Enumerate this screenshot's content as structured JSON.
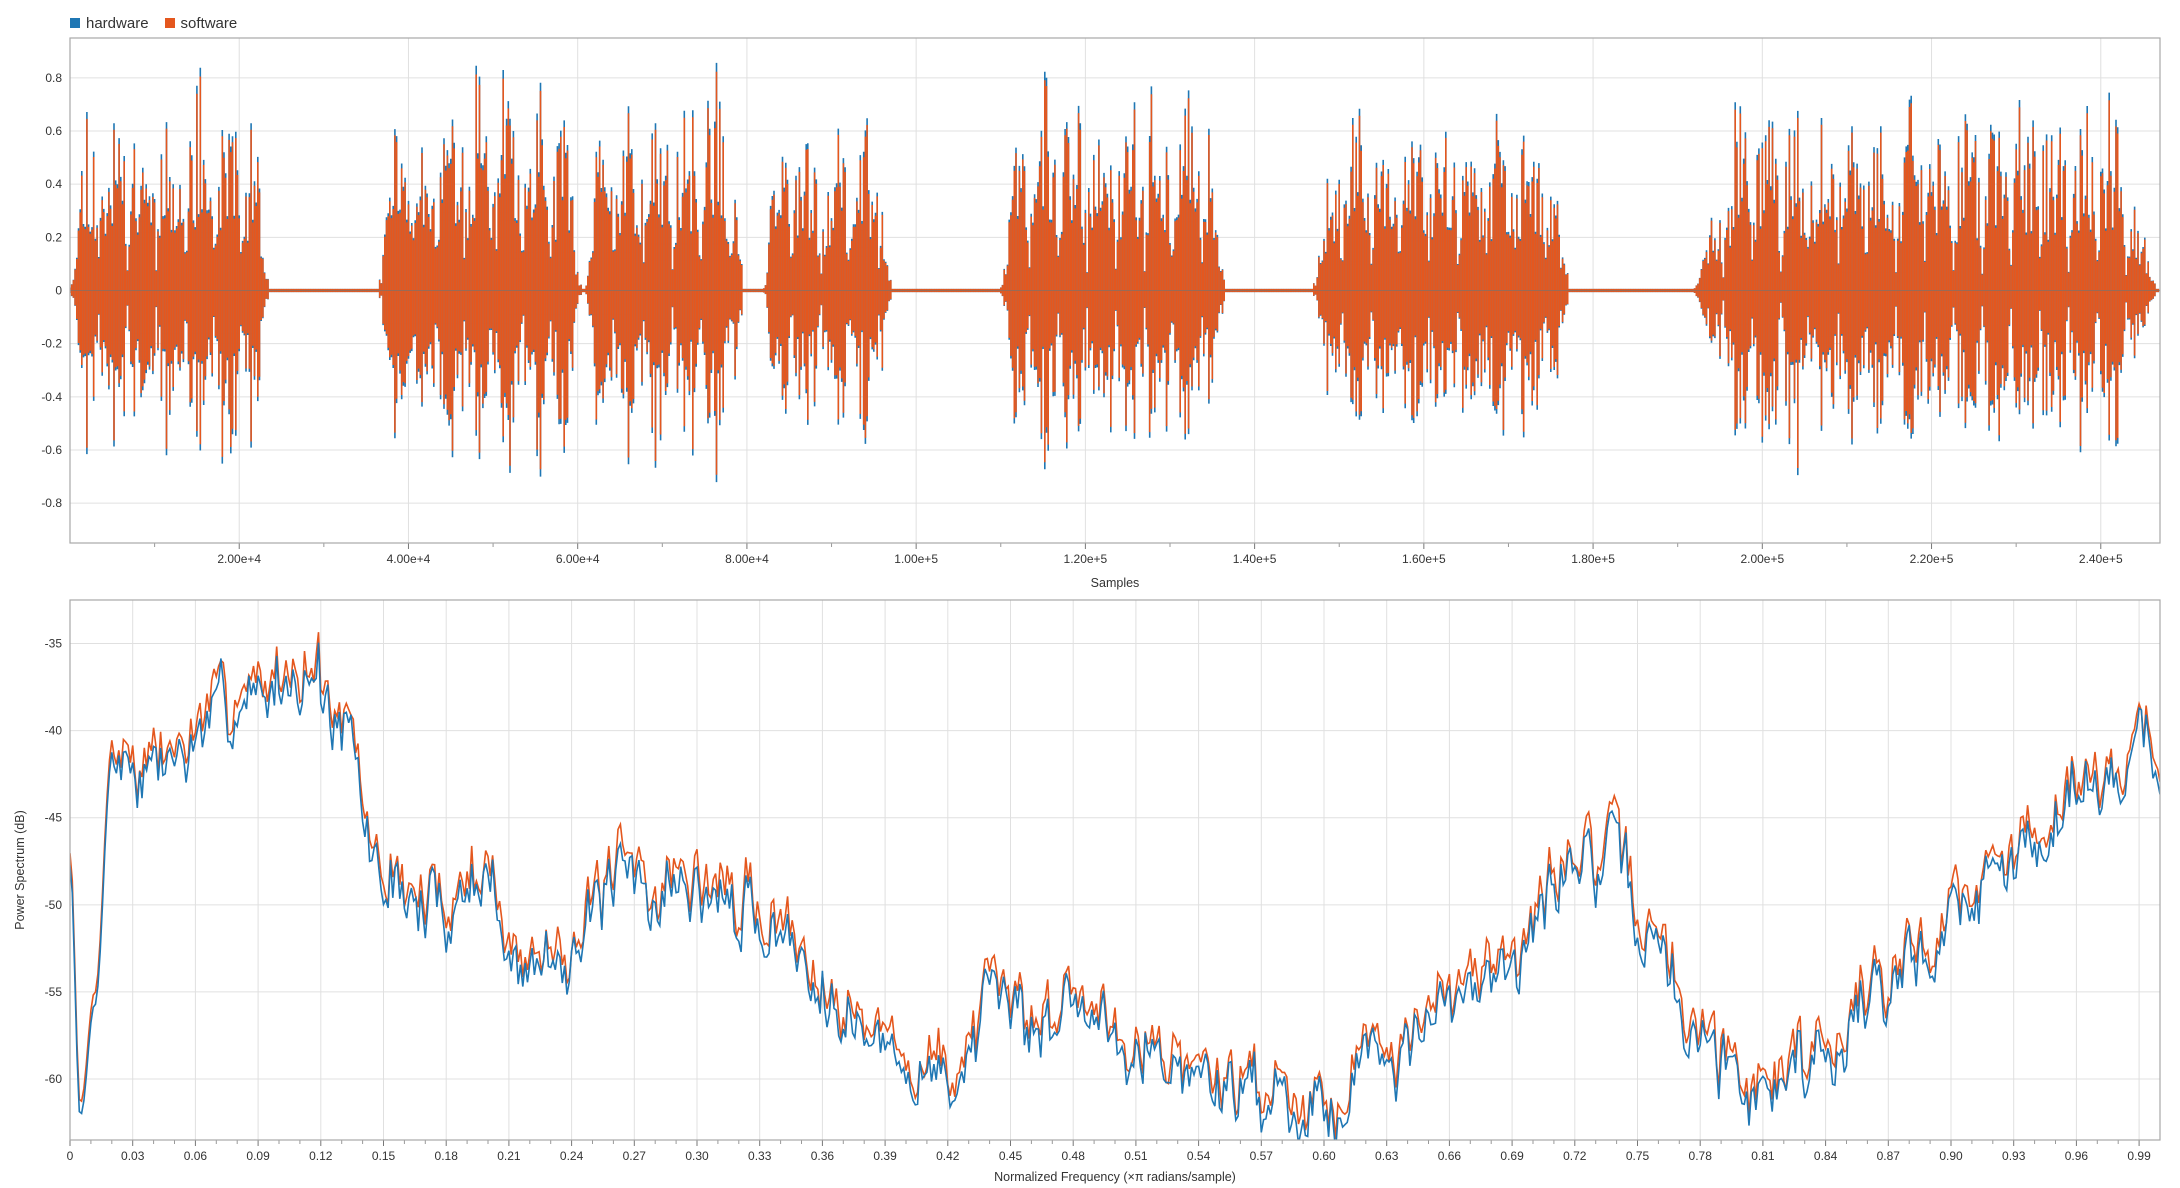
{
  "legend": {
    "items": [
      {
        "label": "hardware",
        "color": "#1f77b4"
      },
      {
        "label": "software",
        "color": "#e4571e"
      }
    ]
  },
  "colors": {
    "hardware": "#1f77b4",
    "software": "#e4571e",
    "grid": "#e0e0e0",
    "frame": "#a8a8a8"
  },
  "chart_data": [
    {
      "type": "line",
      "title": "",
      "xlabel": "Samples",
      "ylabel": "",
      "xlim": [
        0,
        247000
      ],
      "ylim": [
        -0.95,
        0.95
      ],
      "x_ticks": [
        20000,
        40000,
        60000,
        80000,
        100000,
        120000,
        140000,
        160000,
        180000,
        200000,
        220000,
        240000
      ],
      "x_tick_labels": [
        "2.00e+4",
        "4.00e+4",
        "6.00e+4",
        "8.00e+4",
        "1.00e+5",
        "1.20e+5",
        "1.40e+5",
        "1.60e+5",
        "1.80e+5",
        "2.00e+5",
        "2.20e+5",
        "2.40e+5"
      ],
      "y_ticks": [
        -0.8,
        -0.6,
        -0.4,
        -0.2,
        0,
        0.2,
        0.4,
        0.6,
        0.8
      ],
      "y_tick_labels": [
        "-0.8",
        "-0.6",
        "-0.4",
        "-0.2",
        "0",
        "0.2",
        "0.4",
        "0.6",
        "0.8"
      ],
      "grid": true,
      "legend_position": "top-left",
      "series": [
        {
          "name": "hardware",
          "color": "#1f77b4"
        },
        {
          "name": "software",
          "color": "#e4571e"
        }
      ],
      "speech_segments": [
        {
          "start": 0,
          "end": 23500,
          "amp": 0.88
        },
        {
          "start": 36500,
          "end": 60500,
          "amp": 0.9
        },
        {
          "start": 61000,
          "end": 79500,
          "amp": 0.89
        },
        {
          "start": 82000,
          "end": 97000,
          "amp": 0.73
        },
        {
          "start": 110000,
          "end": 136500,
          "amp": 0.89
        },
        {
          "start": 147000,
          "end": 177000,
          "amp": 0.8
        },
        {
          "start": 192000,
          "end": 246500,
          "amp": 0.82
        }
      ]
    },
    {
      "type": "line",
      "title": "",
      "xlabel": "Normalized Frequency (×π radians/sample)",
      "ylabel": "Power Spectrum (dB)",
      "xlim": [
        0,
        1.0
      ],
      "ylim": [
        -63.5,
        -32.5
      ],
      "x_ticks": [
        0,
        0.03,
        0.06,
        0.09,
        0.12,
        0.15,
        0.18,
        0.21,
        0.24,
        0.27,
        0.3,
        0.33,
        0.36,
        0.39,
        0.42,
        0.45,
        0.48,
        0.51,
        0.54,
        0.57,
        0.6,
        0.63,
        0.66,
        0.69,
        0.72,
        0.75,
        0.78,
        0.81,
        0.84,
        0.87,
        0.9,
        0.93,
        0.96,
        0.99
      ],
      "x_tick_labels": [
        "0",
        "0.03",
        "0.06",
        "0.09",
        "0.12",
        "0.15",
        "0.18",
        "0.21",
        "0.24",
        "0.27",
        "0.30",
        "0.33",
        "0.36",
        "0.39",
        "0.42",
        "0.45",
        "0.48",
        "0.51",
        "0.54",
        "0.57",
        "0.60",
        "0.63",
        "0.66",
        "0.69",
        "0.72",
        "0.75",
        "0.78",
        "0.81",
        "0.84",
        "0.87",
        "0.90",
        "0.93",
        "0.96",
        "0.99"
      ],
      "y_ticks": [
        -60,
        -55,
        -50,
        -45,
        -40,
        -35
      ],
      "y_tick_labels": [
        "-60",
        "-55",
        "-50",
        "-45",
        "-40",
        "-35"
      ],
      "grid": true,
      "series": [
        {
          "name": "hardware",
          "color": "#1f77b4",
          "offset_db": -0.7
        },
        {
          "name": "software",
          "color": "#e4571e",
          "offset_db": 0
        }
      ],
      "envelope": {
        "x": [
          0,
          0.005,
          0.012,
          0.02,
          0.04,
          0.06,
          0.09,
          0.115,
          0.13,
          0.15,
          0.18,
          0.2,
          0.21,
          0.24,
          0.27,
          0.3,
          0.33,
          0.36,
          0.39,
          0.42,
          0.45,
          0.48,
          0.51,
          0.54,
          0.57,
          0.6,
          0.63,
          0.66,
          0.69,
          0.72,
          0.74,
          0.76,
          0.78,
          0.81,
          0.84,
          0.87,
          0.9,
          0.93,
          0.96,
          0.99,
          1.0
        ],
        "y": [
          -47,
          -61.5,
          -55,
          -41,
          -42,
          -40,
          -36.5,
          -36,
          -40,
          -48,
          -49.5,
          -47,
          -53,
          -51,
          -48,
          -48.5,
          -50,
          -53,
          -58,
          -59,
          -56,
          -55,
          -56.5,
          -59.5,
          -60,
          -60.5,
          -57,
          -56,
          -52,
          -46.5,
          -47.5,
          -52,
          -57,
          -59.5,
          -57.5,
          -54,
          -50,
          -47,
          -42.5,
          -40.5,
          -41
        ]
      }
    }
  ]
}
